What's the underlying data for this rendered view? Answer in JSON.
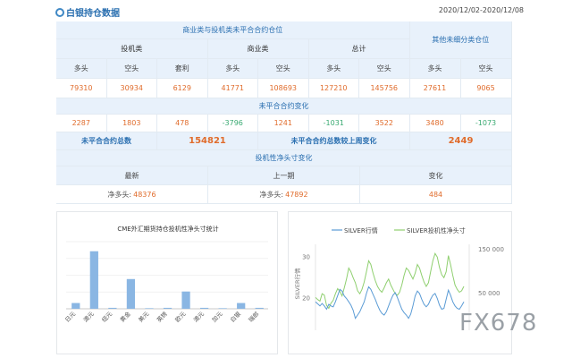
{
  "header": {
    "title": "白银持仓数据",
    "date": "2020/12/02-2020/12/08"
  },
  "table": {
    "top_header": "商业类与投机类未平合合约仓位",
    "other_header": "其他未细分类仓位",
    "groups": [
      "投机类",
      "商业类",
      "总计"
    ],
    "cols": [
      "多头",
      "空头",
      "套利",
      "多头",
      "空头",
      "多头",
      "空头",
      "多头",
      "空头"
    ],
    "vals1": [
      "79310",
      "30934",
      "6129",
      "41771",
      "108693",
      "127210",
      "145756",
      "27611",
      "9065"
    ],
    "sec2": "未平合合约变化",
    "vals2": [
      "2287",
      "1803",
      "478",
      "-3796",
      "1241",
      "-1031",
      "3522",
      "3480",
      "-1073"
    ],
    "total_label": "未平合合约总数",
    "total_value": "154821",
    "change_label": "未平合合约总数较上周变化",
    "change_value": "2449",
    "sec3": "投机性净头寸变化",
    "c3_headers": [
      "最新",
      "上一期",
      "变化"
    ],
    "net_label": "净多头:",
    "latest": "48376",
    "previous": "47892",
    "diff": "484"
  },
  "chart_data": [
    {
      "type": "bar",
      "title": "CME外汇期货持仓投机性净头寸统计",
      "categories": [
        "日元",
        "澳元",
        "纽元",
        "黄金",
        "美元",
        "英镑",
        "欧元",
        "澳元",
        "加元",
        "白银",
        "瑞郎"
      ],
      "values": [
        3,
        30,
        0.5,
        15.5,
        0.3,
        0.5,
        9,
        0.5,
        0.3,
        3,
        0.5
      ],
      "ylim": [
        0,
        35
      ],
      "color": "#8ab6e3"
    },
    {
      "type": "line",
      "series": [
        {
          "name": "SILVER行情",
          "color": "#5a9bd5",
          "axis": "left",
          "values": [
            19,
            18.5,
            18,
            18.6,
            18,
            17.2,
            18.4,
            18,
            17.8,
            19,
            20.5,
            22,
            21.6,
            20.4,
            19.8,
            19,
            18.2,
            17,
            15,
            15.8,
            16.6,
            17.8,
            19,
            21,
            22.6,
            22,
            20.8,
            19.6,
            18.2,
            17,
            16.2,
            15.8,
            16.6,
            18,
            19.4,
            20.6,
            21.2,
            20,
            18.6,
            17.2,
            16.4,
            15.8,
            15,
            16,
            18,
            20.4,
            21.6,
            21,
            19.6,
            18.4,
            17.8,
            18.4,
            19.6,
            20.6,
            21,
            19.8,
            18.2,
            17.2,
            17.4,
            19.6,
            21.8,
            20.6,
            19,
            18,
            17.4,
            17.2,
            18,
            19
          ]
        },
        {
          "name": "SILVER投机性净头寸",
          "color": "#8fcf6f",
          "axis": "right",
          "values": [
            55000,
            52000,
            50000,
            60000,
            58000,
            44000,
            40000,
            47000,
            51000,
            60000,
            67000,
            63000,
            57000,
            68000,
            80000,
            95000,
            90000,
            82000,
            75000,
            64000,
            60000,
            66000,
            76000,
            90000,
            105000,
            100000,
            88000,
            78000,
            70000,
            65000,
            62000,
            68000,
            75000,
            80000,
            72000,
            66000,
            60000,
            58000,
            62000,
            72000,
            85000,
            95000,
            92000,
            86000,
            80000,
            88000,
            100000,
            95000,
            85000,
            76000,
            70000,
            75000,
            90000,
            105000,
            115000,
            110000,
            96000,
            86000,
            82000,
            90000,
            112000,
            100000,
            85000,
            72000,
            66000,
            62000,
            64000,
            70000
          ]
        }
      ],
      "yleft": {
        "ticks": [
          20,
          30
        ],
        "ylim": [
          13,
          32
        ],
        "label": "SILVER行情"
      },
      "yright": {
        "ticks": [
          "50 000",
          "150 000"
        ]
      }
    }
  ],
  "watermark": "FX678"
}
